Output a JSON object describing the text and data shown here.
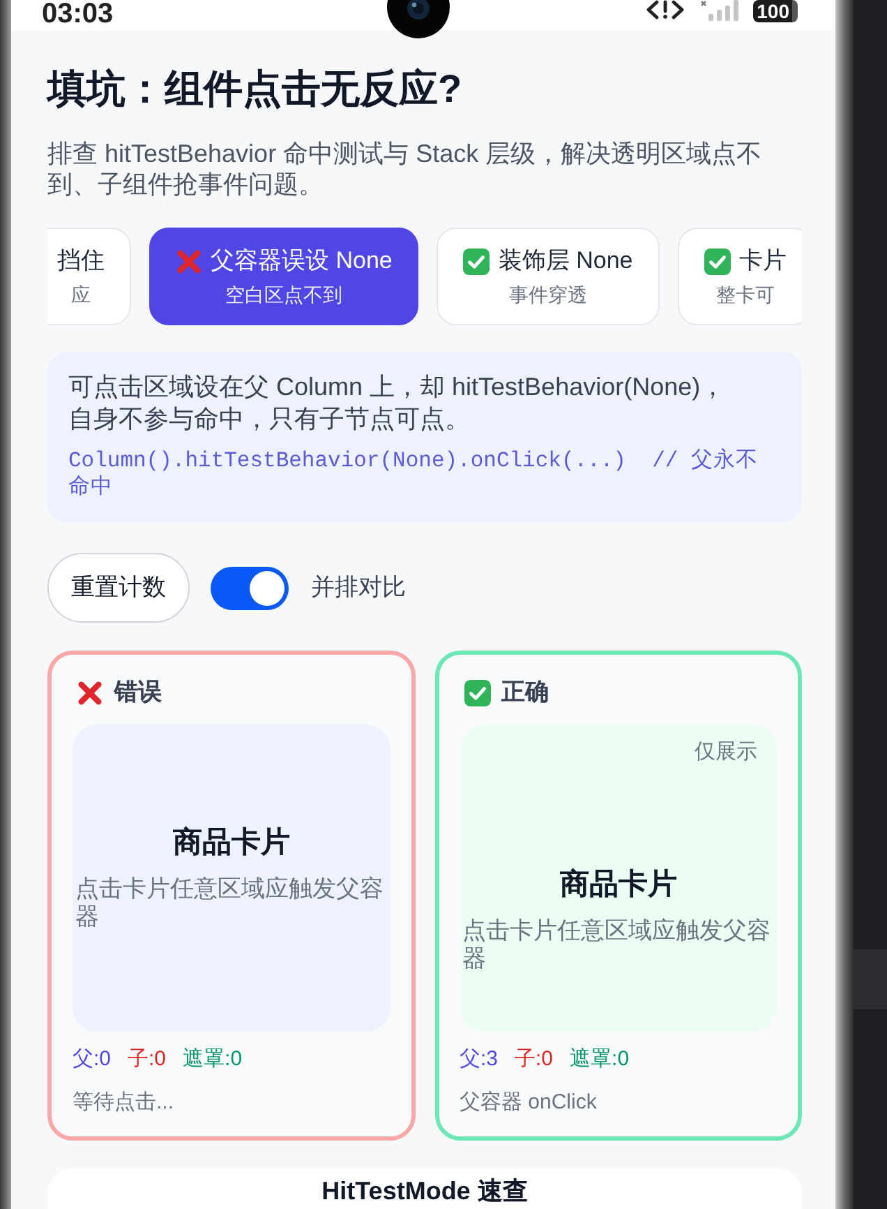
{
  "status_bar": {
    "time": "03:03",
    "battery": "100"
  },
  "title": "填坑：组件点击无反应?",
  "subtitle": "排查 hitTestBehavior 命中测试与 Stack 层级，解决透明区域点不到、子组件抢事件问题。",
  "scenarios": [
    {
      "kind": "plain",
      "title": "挡住",
      "subtitle": "应",
      "selected": false
    },
    {
      "kind": "wrong",
      "title": "父容器误设 None",
      "subtitle": "空白区点不到",
      "selected": true
    },
    {
      "kind": "right",
      "title": "装饰层 None",
      "subtitle": "事件穿透",
      "selected": false
    },
    {
      "kind": "right",
      "title": "卡片",
      "subtitle": "整卡可",
      "selected": false
    }
  ],
  "explanation": {
    "text": "可点击区域设在父 Column 上，却 hitTestBehavior(None)，自身不参与命中，只有子节点可点。",
    "code": "Column().hitTestBehavior(None).onClick(...)  // 父永不命中"
  },
  "controls": {
    "reset_button": "重置计数",
    "compare_toggle": {
      "label": "并排对比",
      "on": true
    }
  },
  "panels": [
    {
      "kind": "wrong",
      "title": "错误",
      "card": {
        "title": "商品卡片",
        "description": "点击卡片任意区域应触发父容器"
      },
      "counters": [
        {
          "label": "父:0",
          "color": "#4f46e5"
        },
        {
          "label": "子:0",
          "color": "#dc2626"
        },
        {
          "label": "遮罩:0",
          "color": "#059669"
        }
      ],
      "status": "等待点击..."
    },
    {
      "kind": "right",
      "title": "正确",
      "card": {
        "tag": "仅展示",
        "title": "商品卡片",
        "description": "点击卡片任意区域应触发父容器"
      },
      "counters": [
        {
          "label": "父:3",
          "color": "#4f46e5"
        },
        {
          "label": "子:0",
          "color": "#dc2626"
        },
        {
          "label": "遮罩:0",
          "color": "#059669"
        }
      ],
      "status": "父容器 onClick"
    }
  ],
  "reference_card": {
    "title": "HitTestMode 速查"
  }
}
